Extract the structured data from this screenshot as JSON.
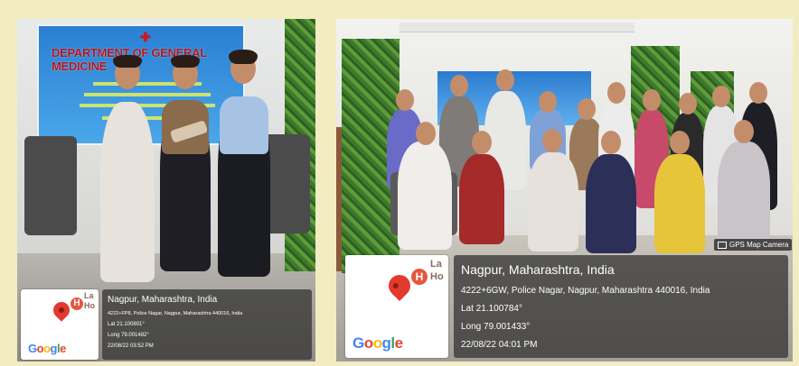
{
  "colors": {
    "border": "#f2ecc2",
    "banner_blue": "#2a7fd2",
    "banner_red": "#b1121a"
  },
  "left_photo": {
    "banner_title": "DEPARTMENT OF GENERAL MEDICINE",
    "gps": {
      "city": "Nagpur, Maharashtra, India",
      "address": "4222+FP8, Police Nagar, Nagpur, Maharashtra 440016, India",
      "lat": "Lat 21.100801°",
      "long": "Long 79.001482°",
      "datetime": "22/08/22 03:52 PM",
      "map_label_1": "La",
      "map_label_2": "Ho",
      "google": [
        "G",
        "o",
        "o",
        "g",
        "l",
        "e"
      ]
    }
  },
  "right_photo": {
    "gps": {
      "badge": "GPS Map Camera",
      "city": "Nagpur, Maharashtra, India",
      "address": "4222+6GW, Police Nagar, Nagpur, Maharashtra 440016, India",
      "lat": "Lat 21.100784°",
      "long": "Long 79.001433°",
      "datetime": "22/08/22 04:01 PM",
      "map_label_1": "La",
      "map_label_2": "Ho",
      "google": [
        "G",
        "o",
        "o",
        "g",
        "l",
        "e"
      ]
    }
  }
}
